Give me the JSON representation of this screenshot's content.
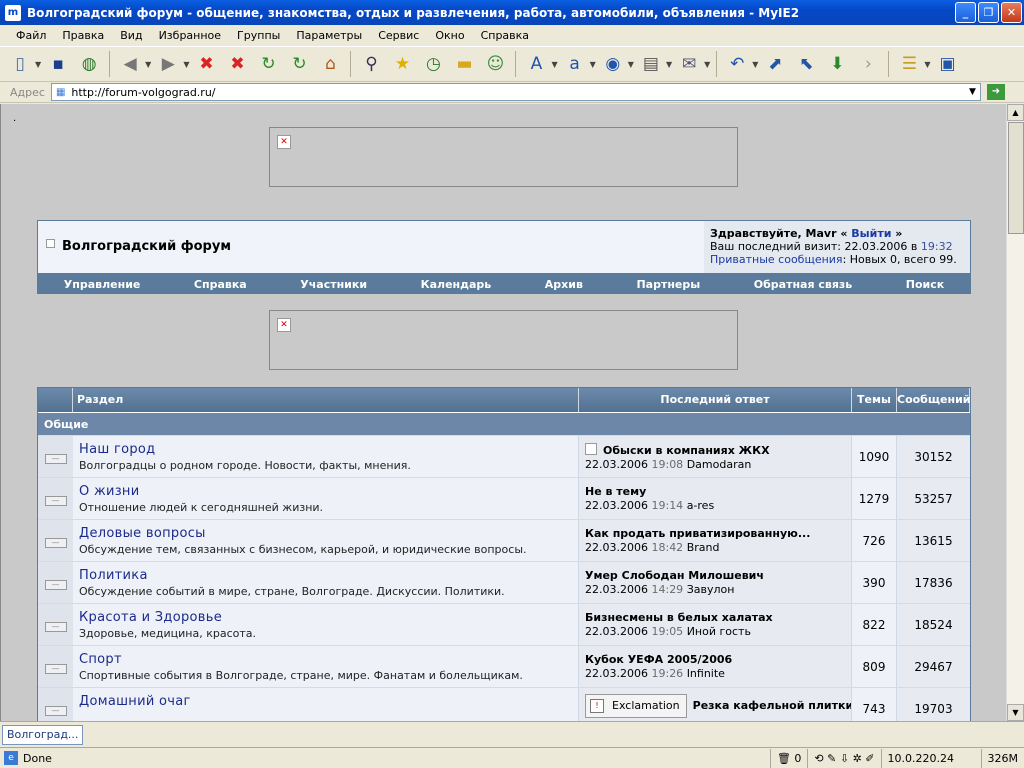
{
  "window": {
    "title": "Волгоградский форум - общение, знакомства, отдых и развлечения, работа, автомобили, объявления - MyIE2"
  },
  "menu": [
    "Файл",
    "Правка",
    "Вид",
    "Избранное",
    "Группы",
    "Параметры",
    "Сервис",
    "Окно",
    "Справка"
  ],
  "toolbar_icons": [
    "new-page-icon",
    "save-icon",
    "offline-icon",
    "back-icon",
    "forward-icon",
    "stop-icon",
    "stop-all-icon",
    "refresh-icon",
    "refresh-all-icon",
    "home-icon",
    "search-icon",
    "favorites-icon",
    "history-icon",
    "folder-icon",
    "user-icon",
    "font-icon",
    "translate-icon",
    "globe-icon",
    "print-icon",
    "mail-icon",
    "undo-icon",
    "open-window-icon",
    "restore-window-icon",
    "download-icon",
    "toggle-icon",
    "layout-icon",
    "window-icon"
  ],
  "address": {
    "label": "Адрес",
    "url": "http://forum-volgograd.ru/"
  },
  "page": {
    "dot": ".",
    "forum_title": "Волгоградский форум",
    "greeting_prefix": "Здравствуйте, Mavr «",
    "logout": "Выйти",
    "greeting_suffix": "»",
    "last_visit_prefix": "Ваш последний визит: 22.03.2006 в",
    "last_visit_time": "19:32",
    "pm_link": "Приватные сообщения",
    "pm_stats": ": Новых 0, всего 99.",
    "nav": [
      "Управление",
      "Справка",
      "Участники",
      "Календарь",
      "Архив",
      "Партнеры",
      "Обратная связь",
      "Поиск"
    ],
    "table_headers": {
      "section": "Раздел",
      "last_reply": "Последний ответ",
      "topics": "Темы",
      "posts": "Сообщений"
    },
    "category": "Общие",
    "forums": [
      {
        "name": "Наш город",
        "desc": "Волгоградцы о родном городе. Новости, факты, мнения.",
        "last_title": "Обыски в компаниях ЖКХ",
        "last_date": "22.03.2006",
        "last_time": "19:08",
        "last_author": "Damodaran",
        "topics": "1090",
        "posts": "30152"
      },
      {
        "name": "О жизни",
        "desc": "Отношение людей к сегодняшней жизни.",
        "last_title": "Не в тему",
        "last_date": "22.03.2006",
        "last_time": "19:14",
        "last_author": "a-res",
        "topics": "1279",
        "posts": "53257"
      },
      {
        "name": "Деловые вопросы",
        "desc": "Обсуждение тем, связанных с бизнесом, карьерой, и юридические вопросы.",
        "last_title": "Как продать приватизированную...",
        "last_date": "22.03.2006",
        "last_time": "18:42",
        "last_author": "Brand",
        "topics": "726",
        "posts": "13615"
      },
      {
        "name": "Политика",
        "desc": "Обсуждение событий в мире, стране, Волгограде. Дискуссии. Политики.",
        "last_title": "Умер Слободан Милошевич",
        "last_date": "22.03.2006",
        "last_time": "14:29",
        "last_author": "Завулон",
        "topics": "390",
        "posts": "17836"
      },
      {
        "name": "Красота и Здоровье",
        "desc": "Здоровье, медицина, красота.",
        "last_title": "Бизнесмены в белых халатах",
        "last_date": "22.03.2006",
        "last_time": "19:05",
        "last_author": "Иной гость",
        "topics": "822",
        "posts": "18524"
      },
      {
        "name": "Спорт",
        "desc": "Спортивные события в Волгограде, стране, мире. Фанатам и болельщикам.",
        "last_title": "Кубок УЕФА 2005/2006",
        "last_date": "22.03.2006",
        "last_time": "19:26",
        "last_author": "Infinite",
        "topics": "809",
        "posts": "29467"
      },
      {
        "name": "Домашний очаг",
        "desc": "",
        "last_title": "Резка кафельной плитки",
        "last_badge": "Exclamation",
        "last_date": "",
        "last_time": "",
        "last_author": "",
        "topics": "743",
        "posts": "19703"
      }
    ]
  },
  "taskbar": {
    "tab": "Волгоград..."
  },
  "status": {
    "text": "Done",
    "trash_count": "0",
    "ip": "10.0.220.24",
    "memory": "326M"
  }
}
